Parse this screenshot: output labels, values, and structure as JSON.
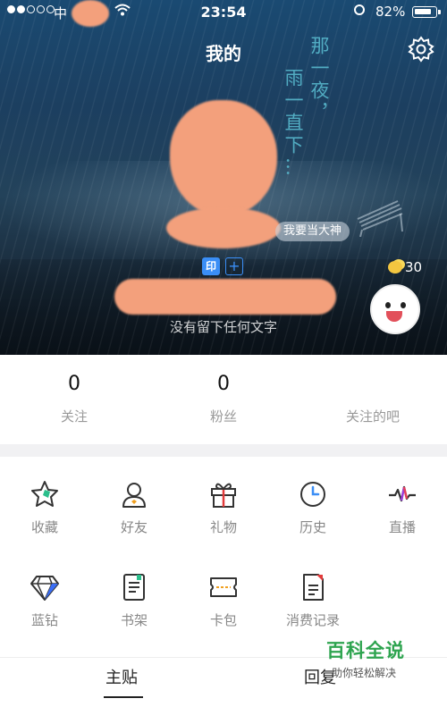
{
  "status_bar": {
    "carrier": "中",
    "time": "23:54",
    "battery": "82%"
  },
  "header": {
    "title": "我的"
  },
  "profile": {
    "poem_col1": "那一夜，",
    "poem_col2": "雨一直下…",
    "tag": "我要当大神",
    "badge_yin": "印",
    "badge_plus": "+",
    "coins": "30",
    "signature": "没有留下任何文字"
  },
  "stats": [
    {
      "value": "0",
      "label": "关注"
    },
    {
      "value": "0",
      "label": "粉丝"
    },
    {
      "value": "",
      "label": "关注的吧"
    }
  ],
  "menu": [
    {
      "label": "收藏",
      "icon": "favorite-star-icon"
    },
    {
      "label": "好友",
      "icon": "friend-person-icon"
    },
    {
      "label": "礼物",
      "icon": "gift-icon"
    },
    {
      "label": "历史",
      "icon": "history-clock-icon"
    },
    {
      "label": "直播",
      "icon": "live-wave-icon"
    },
    {
      "label": "蓝钻",
      "icon": "blue-diamond-icon"
    },
    {
      "label": "书架",
      "icon": "bookshelf-icon"
    },
    {
      "label": "卡包",
      "icon": "card-pack-icon"
    },
    {
      "label": "消费记录",
      "icon": "consumption-record-icon"
    }
  ],
  "tabs": [
    {
      "label": "主贴"
    },
    {
      "label": "回复"
    }
  ],
  "watermark": {
    "title": "百科全说",
    "subtitle": "助你轻松解决"
  }
}
